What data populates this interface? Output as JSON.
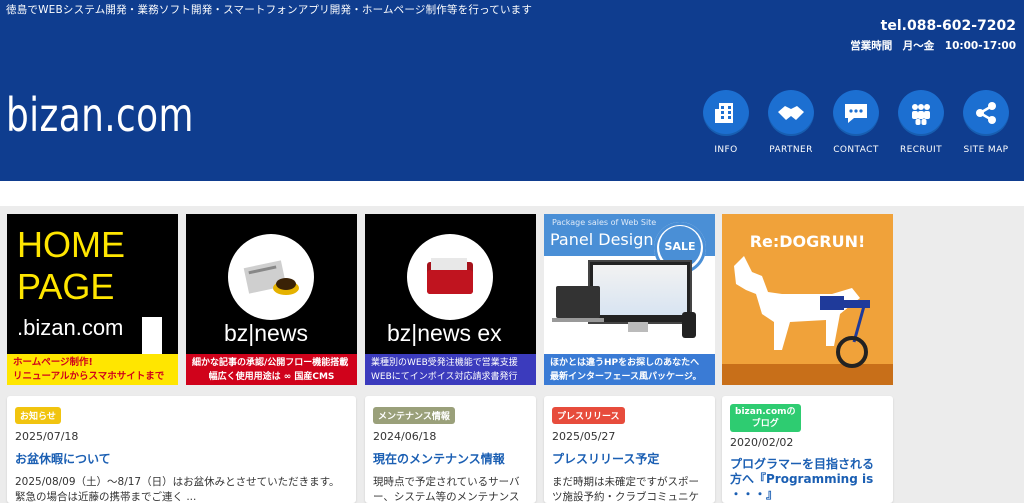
{
  "header": {
    "tagline": "徳島でWEBシステム開発・業務ソフト開発・スマートフォンアプリ開発・ホームページ制作等を行っています",
    "tel": "tel.088-602-7202",
    "hours": "営業時間　月〜金　10:00-17:00",
    "logo": "bizan.com"
  },
  "nav": [
    {
      "label": "INFO",
      "icon": "building-icon"
    },
    {
      "label": "PARTNER",
      "icon": "handshake-icon"
    },
    {
      "label": "CONTACT",
      "icon": "chat-bubble-icon"
    },
    {
      "label": "RECRUIT",
      "icon": "people-icon"
    },
    {
      "label": "SITE MAP",
      "icon": "share-icon"
    }
  ],
  "tiles": {
    "homepage": {
      "big": "HOME PAGE",
      "brand": ".bizan.com",
      "cap1": "ホームページ制作!",
      "cap2": "リニューアルからスマホサイトまで"
    },
    "bznews": {
      "brand": "bz|news",
      "cap1": "細かな記事の承認/公開フロー機能搭載",
      "cap2": "幅広く使用用途は ∞ 国産CMS"
    },
    "bznewsex": {
      "brand": "bz|news ex",
      "cap1": "業種別のWEB受発注機能で営業支援",
      "cap2": "WEBにてインボイス対応請求書発行"
    },
    "panel": {
      "small": "Package sales of Web Site",
      "title": "Panel Design",
      "sale": "SALE",
      "cap1": "ほかとは違うHPをお探しのあなたへ",
      "cap2": "最新インターフェース風パッケージ。"
    },
    "dogrun": {
      "title": "Re:DOGRUN!"
    }
  },
  "cards": [
    {
      "badge": "お知らせ",
      "badge_color": "#f1c40f",
      "date": "2025/07/18",
      "title": "お盆休暇について",
      "body": "2025/08/09（土）〜8/17（日）はお盆休みとさせていただきます。 緊急の場合は近藤の携帯までご連く ..."
    },
    {
      "badge": "メンテナンス情報",
      "badge_color": "#9aa07a",
      "date": "2024/06/18",
      "title": "現在のメンテナンス情報",
      "body": "現時点で予定されているサーバー、システム等のメンテナンス情報は特にありません。"
    },
    {
      "badge": "プレスリリース",
      "badge_color": "#e74c3c",
      "date": "2025/05/27",
      "title": "プレスリリース予定",
      "body": "まだ時期は未確定ですがスポーツ施設予約・クラブコミュニケーション..."
    },
    {
      "badge": "bizan.comの\nブログ",
      "badge_color": "#2ecc71",
      "date": "2020/02/02",
      "title": "プログラマーを目指される方へ『Programming is ・・・』",
      "body": ""
    }
  ]
}
